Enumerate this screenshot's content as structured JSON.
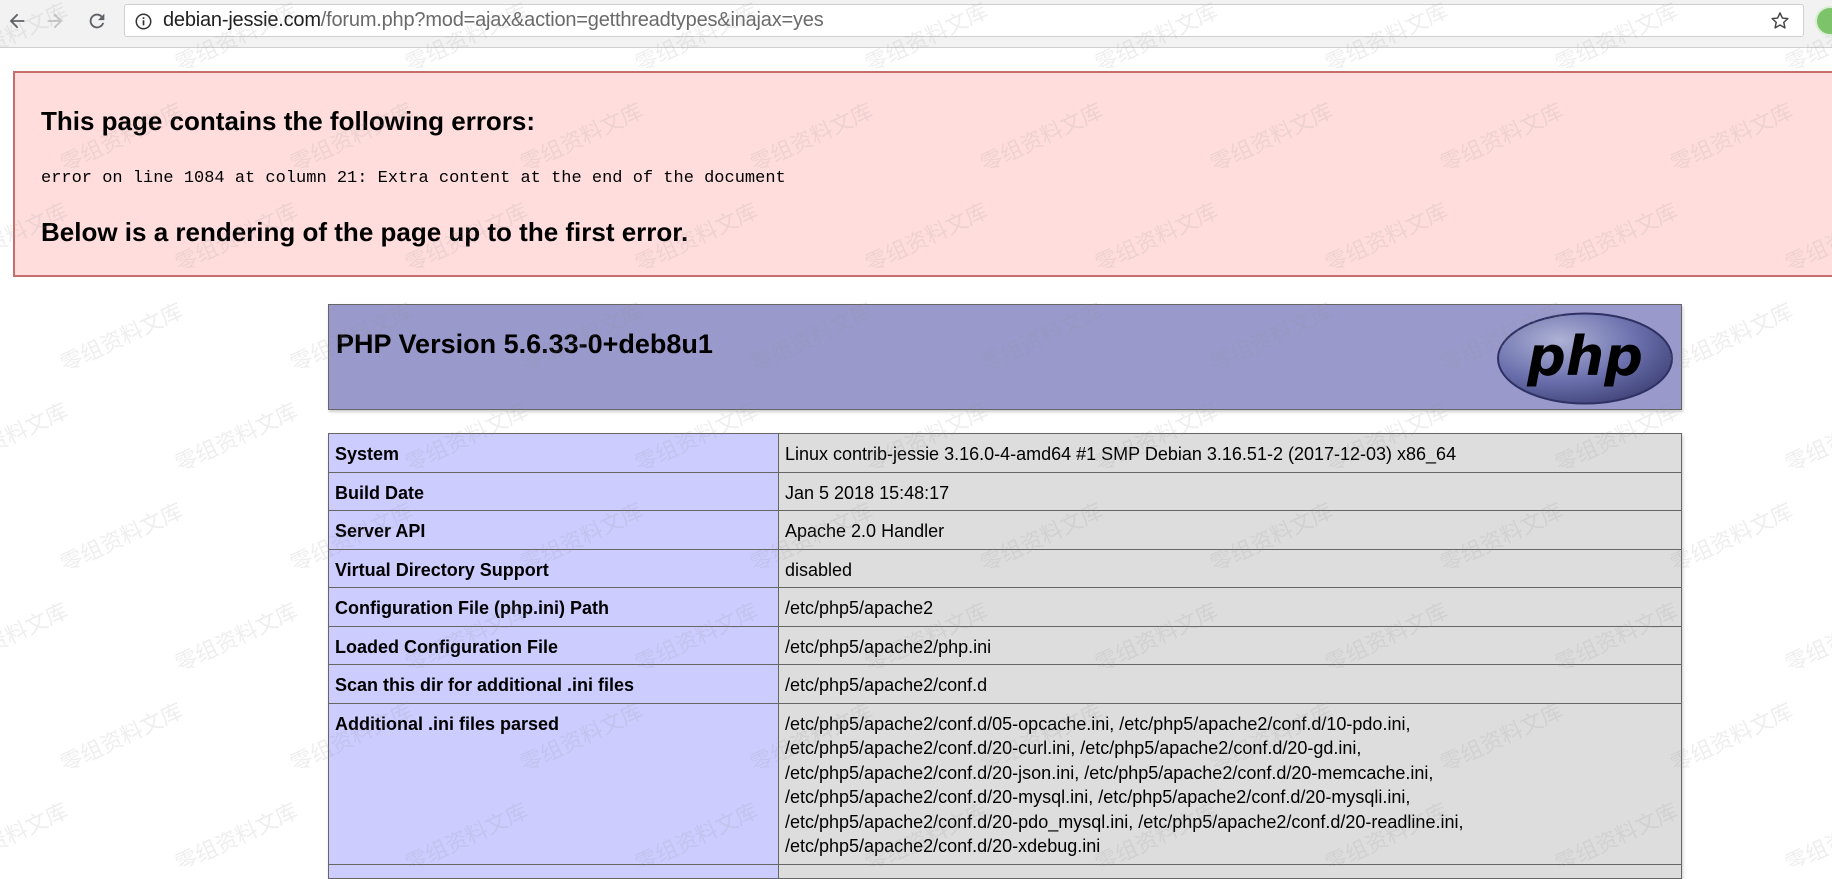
{
  "browser": {
    "url_host": "debian-jessie.com",
    "url_path": "/forum.php?mod=ajax&action=getthreadtypes&inajax=yes"
  },
  "error_box": {
    "title": "This page contains the following errors:",
    "message": "error on line 1084 at column 21: Extra content at the end of the document",
    "below": "Below is a rendering of the page up to the first error."
  },
  "phpinfo": {
    "title": "PHP Version 5.6.33-0+deb8u1",
    "logo_text": "php",
    "rows": [
      {
        "key": "System",
        "value": [
          "Linux contrib-jessie 3.16.0-4-amd64 #1 SMP Debian 3.16.51-2 (2017-12-03) x86_64"
        ]
      },
      {
        "key": "Build Date",
        "value": [
          "Jan 5 2018 15:48:17"
        ]
      },
      {
        "key": "Server API",
        "value": [
          "Apache 2.0 Handler"
        ]
      },
      {
        "key": "Virtual Directory Support",
        "value": [
          "disabled"
        ]
      },
      {
        "key": "Configuration File (php.ini) Path",
        "value": [
          "/etc/php5/apache2"
        ]
      },
      {
        "key": "Loaded Configuration File",
        "value": [
          "/etc/php5/apache2/php.ini"
        ]
      },
      {
        "key": "Scan this dir for additional .ini files",
        "value": [
          "/etc/php5/apache2/conf.d"
        ]
      },
      {
        "key": "Additional .ini files parsed",
        "value": [
          "/etc/php5/apache2/conf.d/05-opcache.ini, /etc/php5/apache2/conf.d/10-pdo.ini,",
          "/etc/php5/apache2/conf.d/20-curl.ini, /etc/php5/apache2/conf.d/20-gd.ini,",
          "/etc/php5/apache2/conf.d/20-json.ini, /etc/php5/apache2/conf.d/20-memcache.ini,",
          "/etc/php5/apache2/conf.d/20-mysql.ini, /etc/php5/apache2/conf.d/20-mysqli.ini,",
          "/etc/php5/apache2/conf.d/20-pdo_mysql.ini, /etc/php5/apache2/conf.d/20-readline.ini,",
          "/etc/php5/apache2/conf.d/20-xdebug.ini"
        ]
      },
      {
        "key": "",
        "value": [
          ""
        ]
      }
    ]
  },
  "watermark_text": "零组资料文库"
}
